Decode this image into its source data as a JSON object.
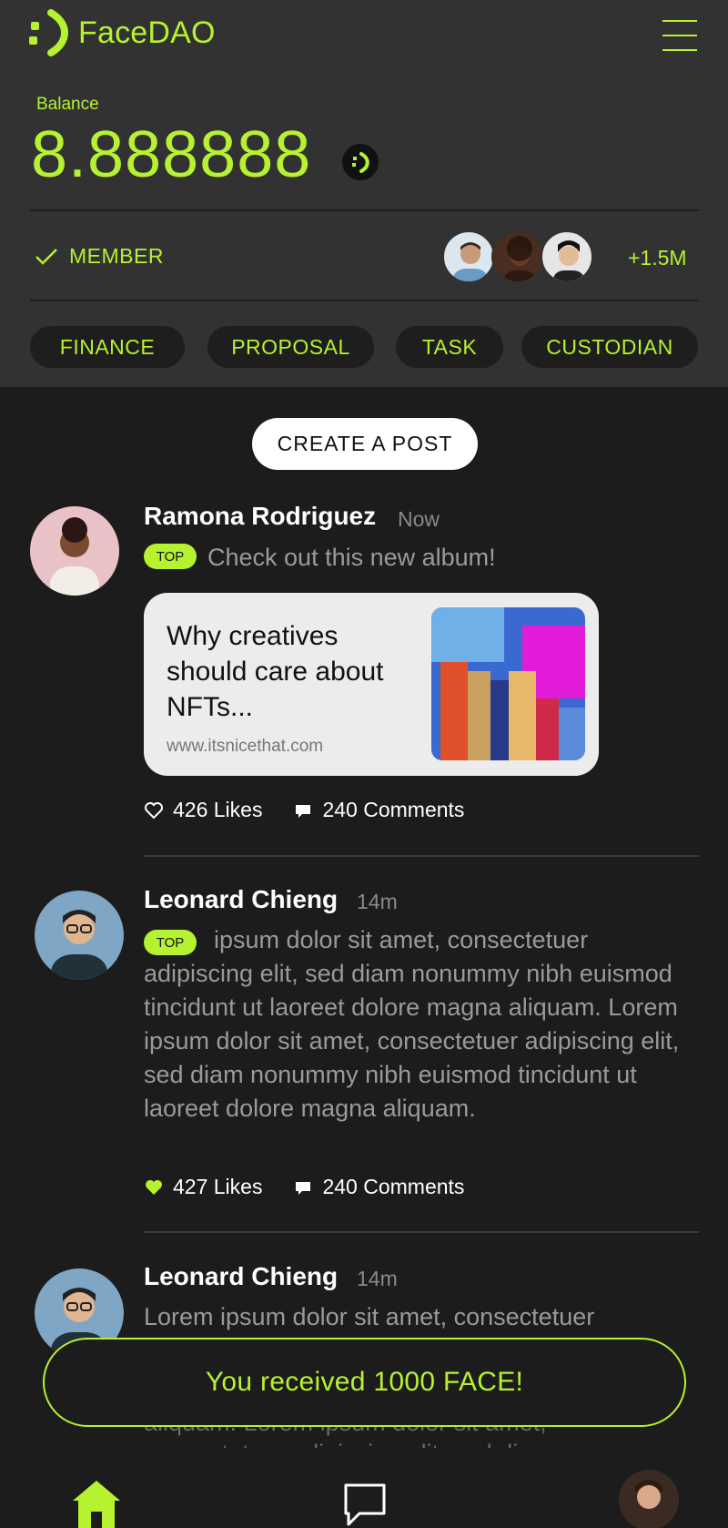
{
  "app": {
    "title": "FaceDAO"
  },
  "balance": {
    "label": "Balance",
    "value": "8.888888"
  },
  "member": {
    "label": "MEMBER",
    "count": "+1.5M"
  },
  "tabs": [
    {
      "label": "FINANCE"
    },
    {
      "label": "PROPOSAL"
    },
    {
      "label": "TASK"
    },
    {
      "label": "CUSTODIAN"
    }
  ],
  "create_post": {
    "label": "CREATE A POST"
  },
  "posts": [
    {
      "author": "Ramona Rodriguez",
      "time": "Now",
      "badge": "TOP",
      "text": "Check out this new album!",
      "link": {
        "title": "Why creatives should care about NFTs...",
        "url": "www.itsnicethat.com"
      },
      "likes": "426 Likes",
      "comments": "240 Comments",
      "liked": false
    },
    {
      "author": "Leonard Chieng",
      "time": "14m",
      "badge": "TOP",
      "text": "ipsum dolor sit amet, consectetuer adipiscing elit, sed diam nonummy nibh euismod tincidunt ut laoreet dolore magna aliquam. Lorem ipsum dolor sit amet, consectetuer adipiscing elit, sed diam nonummy nibh euismod tincidunt ut laoreet dolore magna aliquam.",
      "likes": "427 Likes",
      "comments": "240 Comments",
      "liked": true
    },
    {
      "author": "Leonard Chieng",
      "time": "14m",
      "text": "Lorem ipsum dolor sit amet, consectetuer",
      "text_hidden_1": "aliquam. Lorem ipsum dolor sit amet,",
      "text_hidden_2": "consectetuer adipiscing elit, sed diam"
    }
  ],
  "toast": {
    "message": "You received 1000 FACE!"
  },
  "colors": {
    "accent": "#b6f22f",
    "background": "#1c1c1c",
    "header": "#323232"
  },
  "icons": {
    "menu": "hamburger-icon",
    "coin": "face-coin-icon",
    "check": "check-icon",
    "heart": "heart-icon",
    "comment": "comment-icon",
    "home": "home-icon",
    "chat": "chat-icon"
  }
}
